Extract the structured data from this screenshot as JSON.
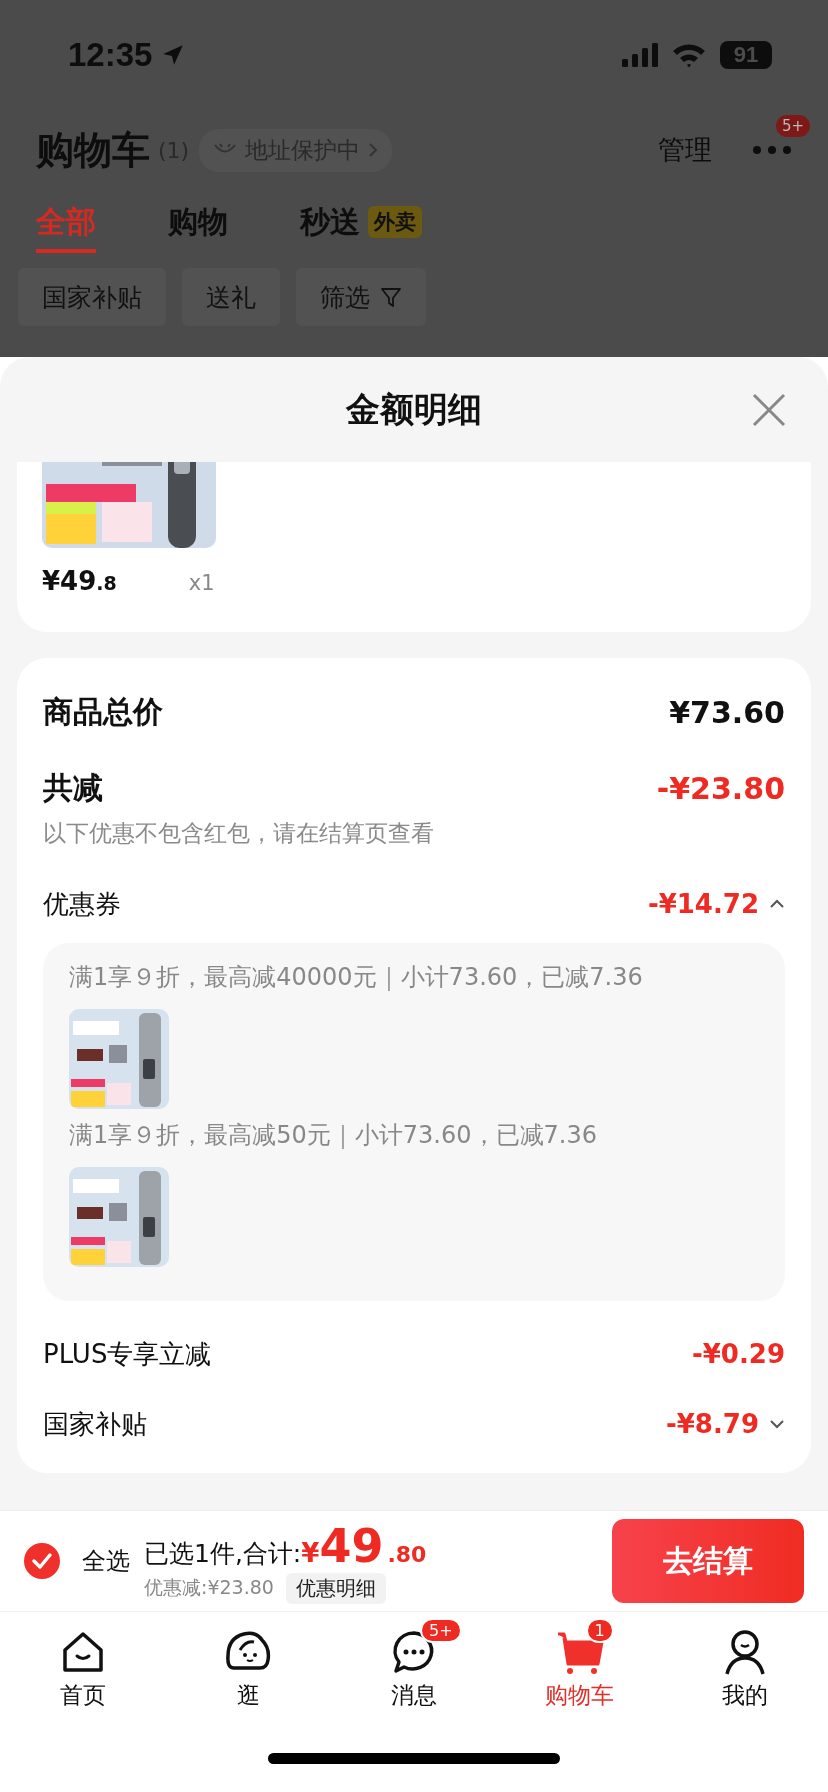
{
  "status_bar": {
    "time": "12:35",
    "battery": "91"
  },
  "header": {
    "title": "购物车",
    "count": "(1)",
    "address_protection": "地址保护中",
    "manage": "管理",
    "more_badge": "5+"
  },
  "tabs": [
    {
      "label": "全部",
      "selected": true
    },
    {
      "label": "购物",
      "selected": false
    },
    {
      "label": "秒送",
      "selected": false,
      "tag": "外卖"
    }
  ],
  "filters": [
    {
      "label": "国家补贴",
      "kind": "plain"
    },
    {
      "label": "送礼",
      "kind": "plain"
    },
    {
      "label": "筛选",
      "kind": "filter"
    }
  ],
  "sheet": {
    "title": "金额明细",
    "product": {
      "price_main": "¥49",
      "price_decimal": ".8",
      "quantity": "x1"
    },
    "total": {
      "label": "商品总价",
      "amount": "¥73.60"
    },
    "reduction": {
      "label": "共减",
      "amount": "-¥23.80",
      "note": "以下优惠不包含红包，请在结算页查看"
    },
    "discounts": [
      {
        "label": "优惠券",
        "amount": "-¥14.72",
        "expanded": true,
        "coupons": [
          {
            "text": "满1享９折，最高减40000元｜小计73.60，已减7.36"
          },
          {
            "text": "满1享９折，最高减50元｜小计73.60，已减7.36"
          }
        ]
      },
      {
        "label": "PLUS专享立减",
        "amount": "-¥0.29"
      },
      {
        "label": "国家补贴",
        "amount": "-¥8.79",
        "expanded": false
      }
    ]
  },
  "checkout": {
    "select_all": {
      "label": "全选",
      "checked": true
    },
    "summary": "已选1件,合计:",
    "currency": "¥",
    "total_main": "49",
    "total_decimal": ".80",
    "saved": "优惠减:¥23.80",
    "detail_button": "优惠明细",
    "button": "去结算"
  },
  "nav": [
    {
      "label": "首页",
      "kind": "home",
      "selected": false
    },
    {
      "label": "逛",
      "kind": "bun",
      "selected": false
    },
    {
      "label": "消息",
      "kind": "chat",
      "selected": false,
      "badge": "5+"
    },
    {
      "label": "购物车",
      "kind": "cart",
      "selected": true,
      "badge": "1"
    },
    {
      "label": "我的",
      "kind": "person",
      "selected": false
    }
  ]
}
